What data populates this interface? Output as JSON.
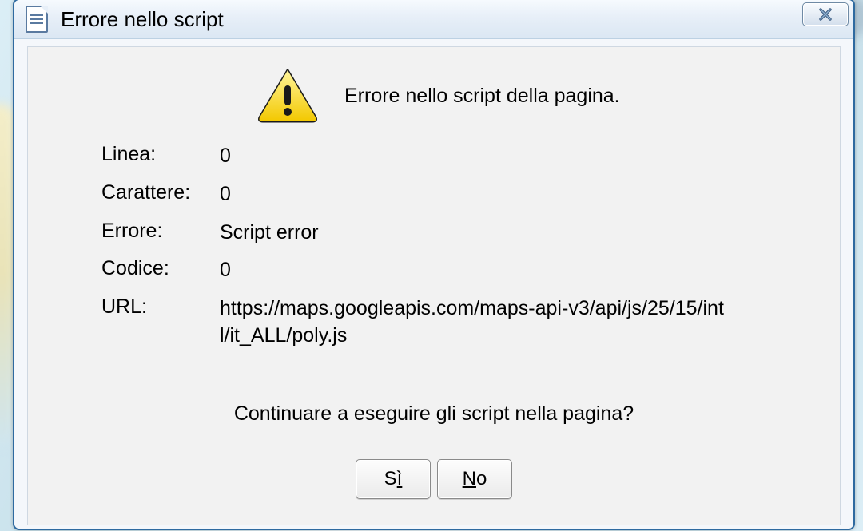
{
  "window": {
    "title": "Errore nello script",
    "close_icon_name": "close-icon"
  },
  "dialog": {
    "heading": "Errore nello script della pagina.",
    "labels": {
      "line": "Linea:",
      "char": "Carattere:",
      "error": "Errore:",
      "code": "Codice:",
      "url": "URL:"
    },
    "values": {
      "line": "0",
      "char": "0",
      "error": "Script error",
      "code": "0",
      "url": "https://maps.googleapis.com/maps-api-v3/api/js/25/15/intl/it_ALL/poly.js"
    },
    "prompt": "Continuare a eseguire gli script nella pagina?",
    "buttons": {
      "yes_prefix": "S",
      "yes_mnemonic": "ì",
      "no_mnemonic": "N",
      "no_suffix": "o"
    }
  }
}
